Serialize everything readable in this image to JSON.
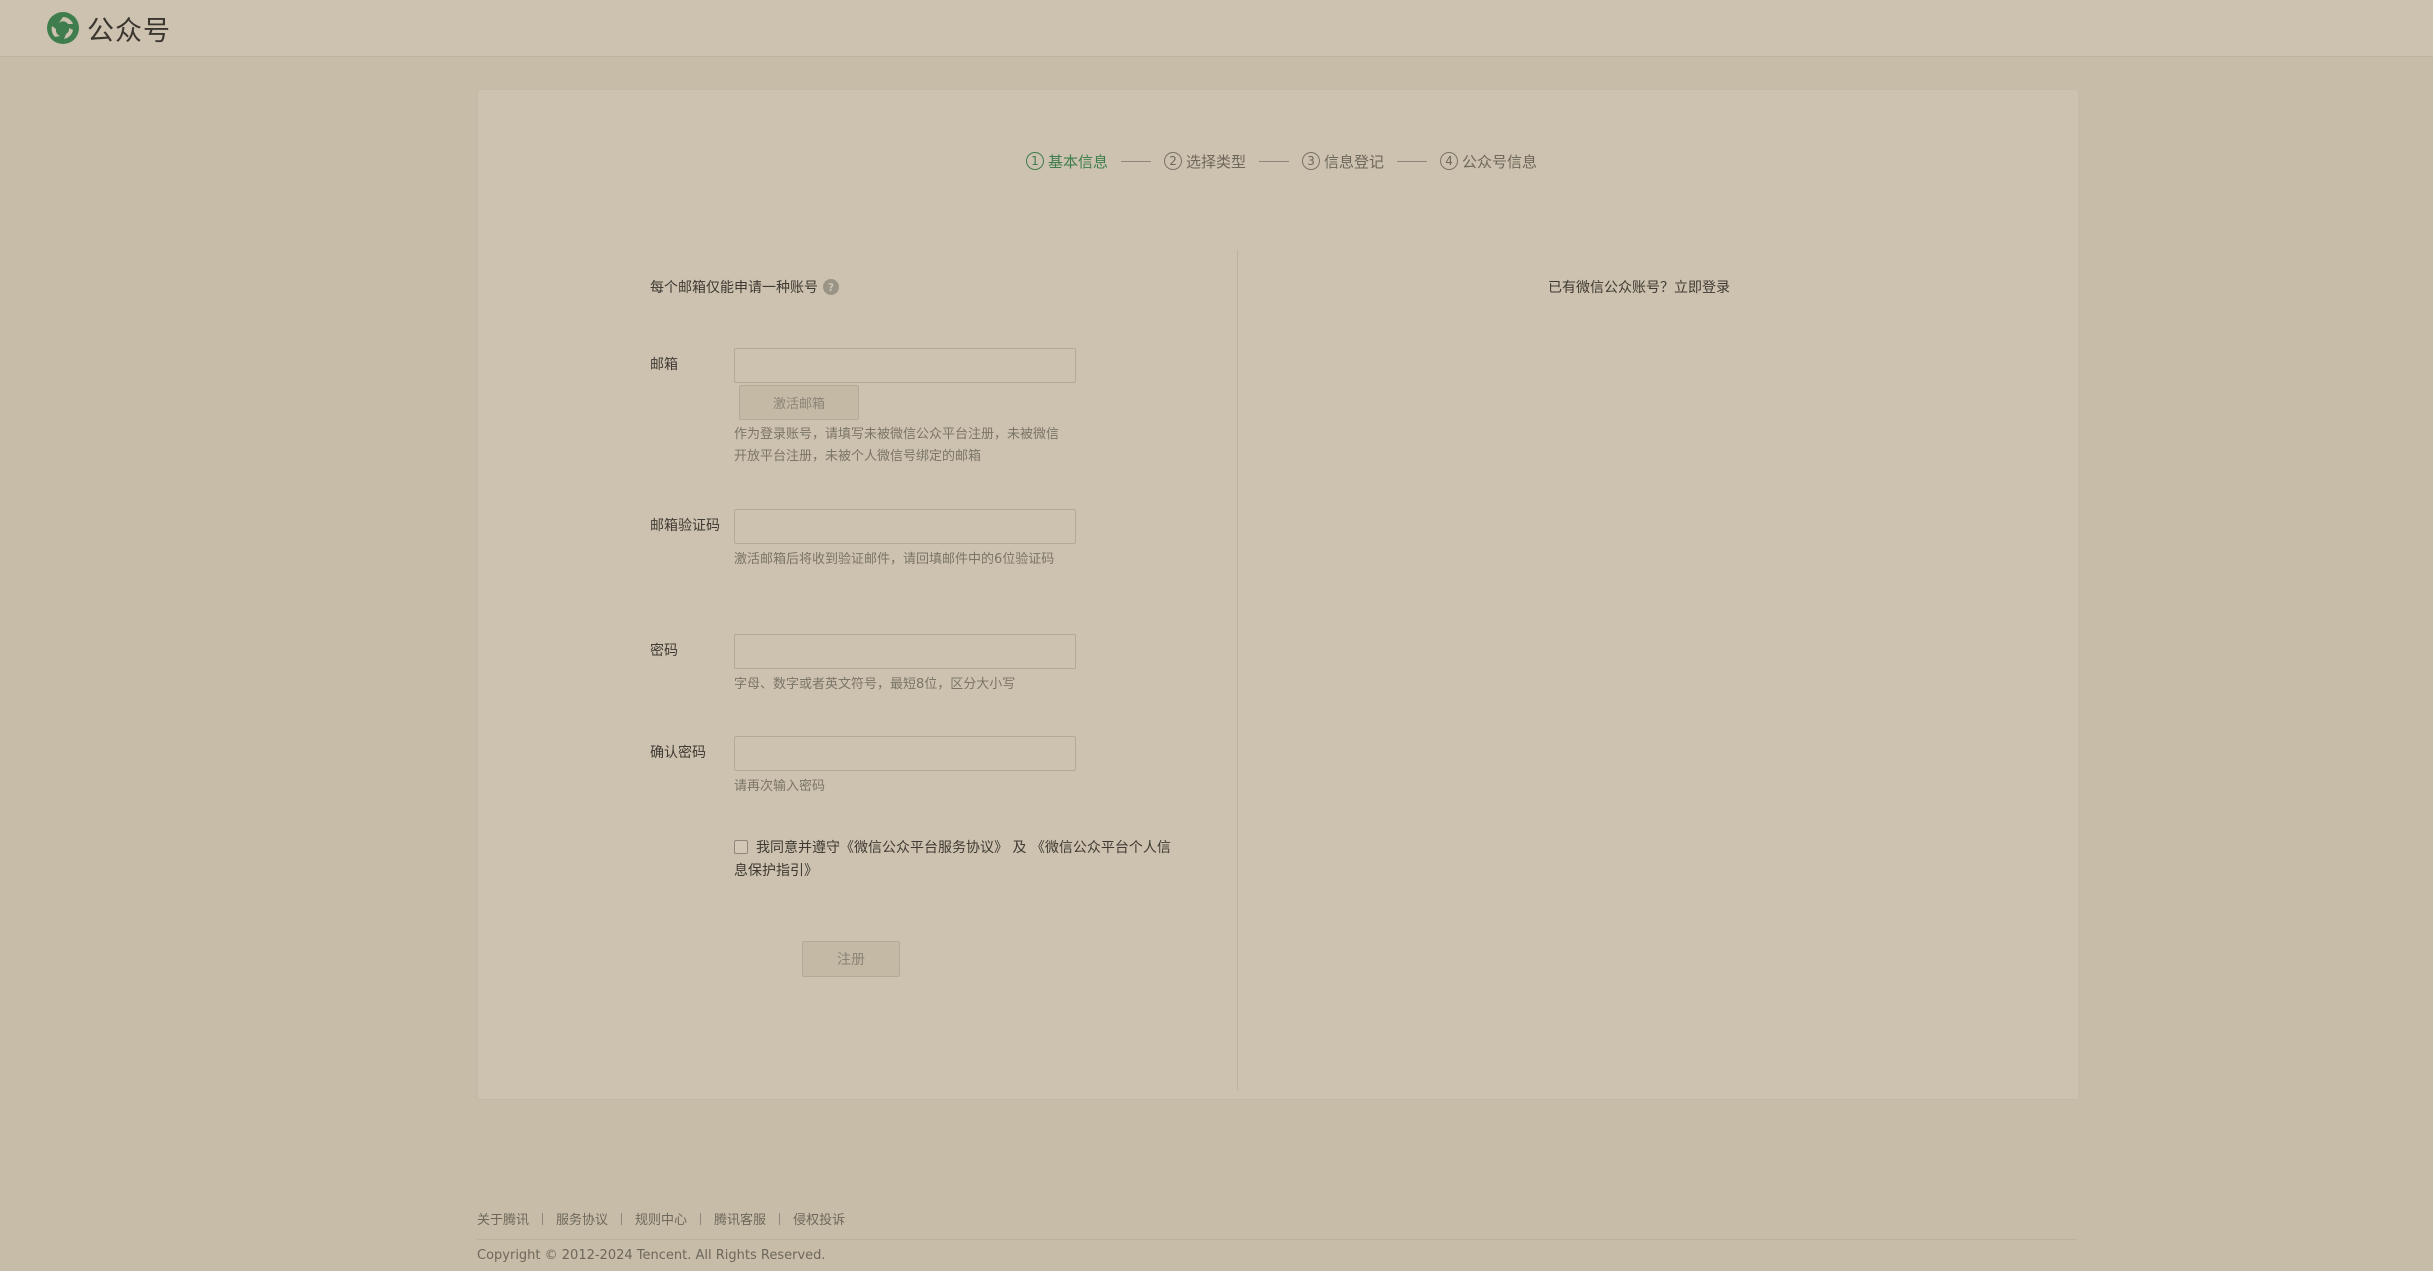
{
  "header": {
    "logo_text": "公众号"
  },
  "steps": [
    {
      "num": "1",
      "label": "基本信息",
      "active": true
    },
    {
      "num": "2",
      "label": "选择类型",
      "active": false
    },
    {
      "num": "3",
      "label": "信息登记",
      "active": false
    },
    {
      "num": "4",
      "label": "公众号信息",
      "active": false
    }
  ],
  "form": {
    "tip": "每个邮箱仅能申请一种账号",
    "email": {
      "label": "邮箱",
      "value": "",
      "placeholder": "",
      "activate_button": "激活邮箱",
      "hint": "作为登录账号，请填写未被微信公众平台注册，未被微信开放平台注册，未被个人微信号绑定的邮箱"
    },
    "code": {
      "label": "邮箱验证码",
      "value": "",
      "placeholder": "",
      "hint": "激活邮箱后将收到验证邮件，请回填邮件中的6位验证码"
    },
    "password": {
      "label": "密码",
      "value": "",
      "placeholder": "",
      "hint": "字母、数字或者英文符号，最短8位，区分大小写"
    },
    "confirm_password": {
      "label": "确认密码",
      "value": "",
      "placeholder": "",
      "hint": "请再次输入密码"
    },
    "agree": {
      "checked": false,
      "prefix": "我同意并遵守",
      "link1": "《微信公众平台服务协议》",
      "and": " 及 ",
      "link2": "《微信公众平台个人信息保护指引》"
    },
    "register_button": "注册"
  },
  "right": {
    "text": "已有微信公众账号？",
    "login_link": "立即登录"
  },
  "footer": {
    "links": [
      "关于腾讯",
      "服务协议",
      "规则中心",
      "腾讯客服",
      "侵权投诉"
    ],
    "copyright": "Copyright © 2012-2024 Tencent. All Rights Reserved."
  },
  "colors": {
    "accent": "#3f7e4c",
    "background": "#c7bca7",
    "panel": "#cdc2af"
  }
}
